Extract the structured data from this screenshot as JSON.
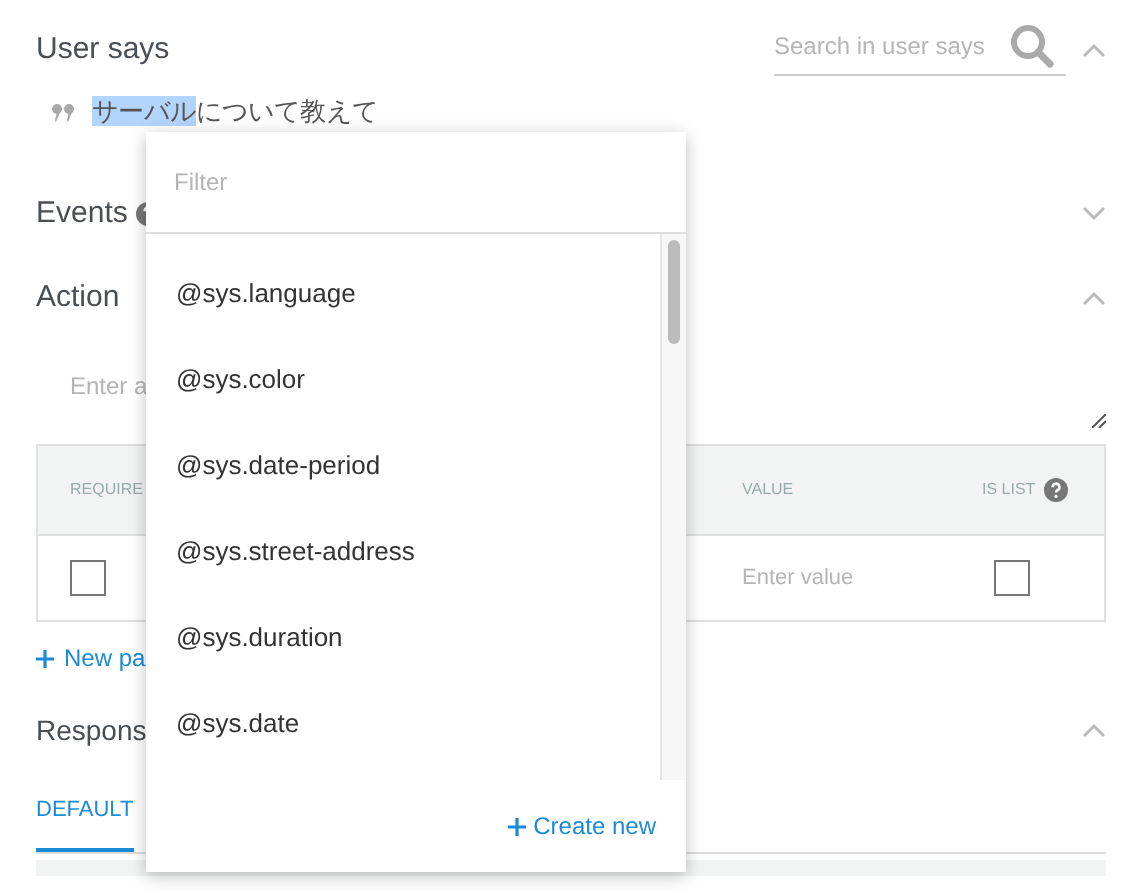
{
  "user_says": {
    "title": "User says",
    "search": {
      "placeholder": "Search in user says"
    },
    "expanded": true,
    "phrases": [
      {
        "segments": [
          {
            "text": "サーバル",
            "highlighted": true
          },
          {
            "text": "について教えて",
            "highlighted": false
          }
        ]
      }
    ]
  },
  "events": {
    "title": "Events",
    "expanded": false
  },
  "action": {
    "title": "Action",
    "expanded": true,
    "input": {
      "placeholder": "Enter a"
    },
    "table": {
      "columns": [
        "REQUIRE",
        "VALUE",
        "IS LIST"
      ],
      "rows": [
        {
          "required": false,
          "value_placeholder": "Enter value",
          "is_list": false
        }
      ]
    },
    "new_parameter": "New pa"
  },
  "responses": {
    "title": "Respons",
    "expanded": true,
    "tabs": [
      {
        "label": "DEFAULT",
        "selected": true
      }
    ]
  },
  "dropdown": {
    "filter": {
      "placeholder": "Filter"
    },
    "items": [
      "@sys.language",
      "@sys.color",
      "@sys.date-period",
      "@sys.street-address",
      "@sys.duration",
      "@sys.date"
    ],
    "create_new": "Create new"
  }
}
